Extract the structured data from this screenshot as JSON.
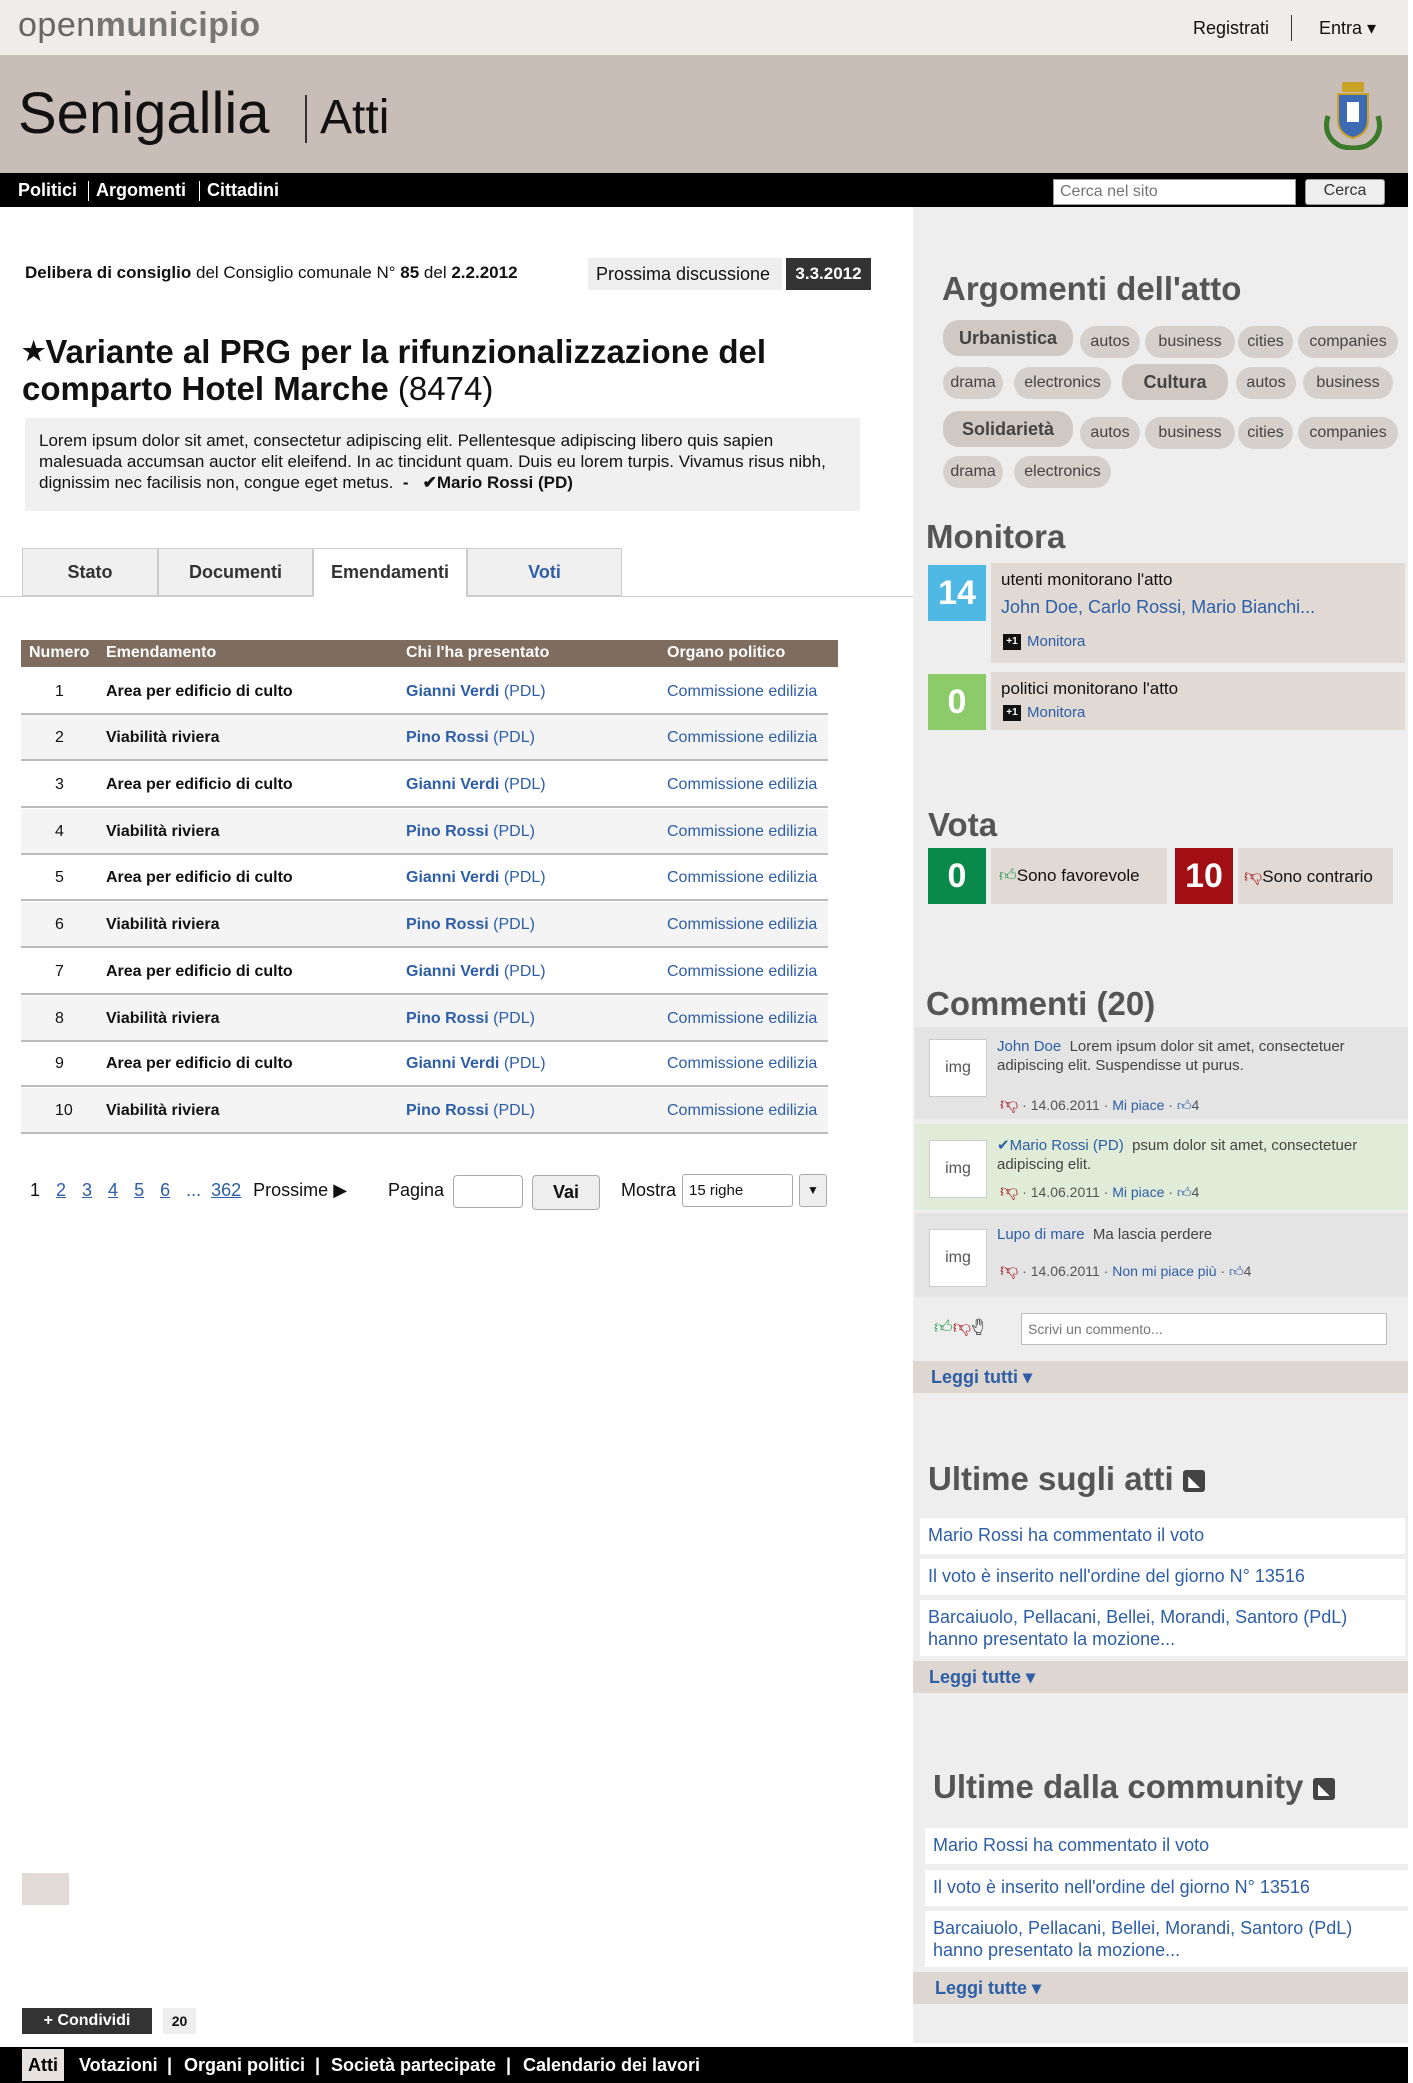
{
  "brand": {
    "open": "open",
    "municipio": "municipio"
  },
  "top": {
    "register": "Registrati",
    "login": "Entra ▾"
  },
  "header": {
    "city": "Senigallia",
    "section": "Atti"
  },
  "nav": {
    "items": [
      "Politici",
      "Argomenti",
      "Cittadini"
    ],
    "search_placeholder": "Cerca nel sito",
    "search_button": "Cerca"
  },
  "act": {
    "type": "Delibera di consiglio",
    "meta1": " del Consiglio comunale N° ",
    "number": "85",
    "meta2": " del ",
    "date": "2.2.2012",
    "next_label": "Prossima discussione",
    "next_date": "3.3.2012",
    "title": "Variante al PRG per la rifunzionalizzazione del comparto Hotel Marche",
    "id": "(8474)",
    "description": "Lorem ipsum dolor sit amet, consectetur adipiscing elit. Pellentesque adipiscing libero quis sapien malesuada accumsan auctor elit eleifend. In ac tincidunt quam. Duis eu lorem turpis. Vivamus risus nibh, dignissim nec facilisis non, congue eget metus.",
    "sep": "-",
    "author": "✔Mario Rossi (PD)"
  },
  "tabs": [
    "Stato",
    "Documenti",
    "Emendamenti",
    "Voti"
  ],
  "table": {
    "headers": [
      "Numero",
      "Emendamento",
      "Chi l'ha presentato",
      "Organo politico"
    ],
    "rows": [
      {
        "n": "1",
        "t": "Area per edificio di culto",
        "who": "Gianni Verdi",
        "party": "(PDL)",
        "org": "Commissione edilizia"
      },
      {
        "n": "2",
        "t": "Viabilità riviera",
        "who": "Pino Rossi",
        "party": "(PDL)",
        "org": "Commissione edilizia"
      },
      {
        "n": "3",
        "t": "Area per edificio di culto",
        "who": "Gianni Verdi",
        "party": "(PDL)",
        "org": "Commissione edilizia"
      },
      {
        "n": "4",
        "t": "Viabilità riviera",
        "who": "Pino Rossi",
        "party": "(PDL)",
        "org": "Commissione edilizia"
      },
      {
        "n": "5",
        "t": "Area per edificio di culto",
        "who": "Gianni Verdi",
        "party": "(PDL)",
        "org": "Commissione edilizia"
      },
      {
        "n": "6",
        "t": "Viabilità riviera",
        "who": "Pino Rossi",
        "party": "(PDL)",
        "org": "Commissione edilizia"
      },
      {
        "n": "7",
        "t": "Area per edificio di culto",
        "who": "Gianni Verdi",
        "party": "(PDL)",
        "org": "Commissione edilizia"
      },
      {
        "n": "8",
        "t": "Viabilità riviera",
        "who": "Pino Rossi",
        "party": "(PDL)",
        "org": "Commissione edilizia"
      },
      {
        "n": "9",
        "t": "Area per edificio di culto",
        "who": "Gianni Verdi",
        "party": "(PDL)",
        "org": "Commissione edilizia"
      },
      {
        "n": "10",
        "t": "Viabilità riviera",
        "who": "Pino Rossi",
        "party": "(PDL)",
        "org": "Commissione edilizia"
      }
    ]
  },
  "pager": {
    "current": "1",
    "pages": [
      "2",
      "3",
      "4",
      "5",
      "6"
    ],
    "ellipsis": "...",
    "last": "362",
    "next": "Prossime",
    "page_label": "Pagina",
    "go": "Vai",
    "show_label": "Mostra",
    "rows_value": "15 righe"
  },
  "share": {
    "label": "+ Condividi",
    "count": "20"
  },
  "footer": {
    "items": [
      "Atti",
      "Votazioni",
      "Organi politici",
      "Società partecipate",
      "Calendario dei lavori"
    ],
    "sep": "|"
  },
  "sidebar": {
    "topics_title": "Argomenti dell'atto",
    "topics": {
      "row1": [
        "Urbanistica",
        "autos",
        "business",
        "cities",
        "companies"
      ],
      "row2": [
        "drama",
        "electronics",
        "Cultura",
        "autos",
        "business"
      ],
      "row3": [
        "Solidarietà",
        "autos",
        "business",
        "cities",
        "companies"
      ],
      "row4": [
        "drama",
        "electronics"
      ]
    },
    "monitor_title": "Monitora",
    "monitor": {
      "users_count": "14",
      "users_label": "utenti monitorano l'atto",
      "users_names": "John Doe, Carlo Rossi, Mario Bianchi...",
      "pol_count": "0",
      "pol_label": "politici monitorano l'atto",
      "action": "Monitora",
      "plus": "+1"
    },
    "vote_title": "Vota",
    "vote": {
      "fav_count": "0",
      "fav_label": "Sono favorevole",
      "con_count": "10",
      "con_label": "Sono contrario",
      "fav_color": "#0a8a4a",
      "con_color": "#a10e13"
    },
    "comments_title": "Commenti (20)",
    "comments": [
      {
        "avatar": "img",
        "author": "John Doe",
        "text": "Lorem ipsum dolor sit amet, consectetuer adipiscing elit. Suspendisse ut purus.",
        "date": "14.06.2011",
        "action": "Mi piace",
        "likes": "4"
      },
      {
        "avatar": "img",
        "author": "✔Mario Rossi (PD)",
        "text": "psum dolor sit amet, consectetuer adipiscing elit.",
        "date": "14.06.2011",
        "action": "Mi piace",
        "likes": "4"
      },
      {
        "avatar": "img",
        "author": "Lupo di mare",
        "text": "Ma lascia perdere",
        "date": "14.06.2011",
        "action": "Non mi piace più",
        "likes": "4"
      }
    ],
    "comment_placeholder": "Scrivi un commento...",
    "read_all": "Leggi tutti ▾",
    "news_title": "Ultime sugli atti",
    "news": [
      "Mario Rossi ha commentato il voto",
      "Il voto è inserito nell'ordine del giorno N° 13516",
      "Barcaiuolo, Pellacani, Bellei, Morandi, Santoro (PdL) hanno presentato la mozione..."
    ],
    "read_all2": "Leggi tutte ▾",
    "community_title": "Ultime dalla community",
    "community": [
      "Mario Rossi ha commentato il voto",
      "Il voto è inserito nell'ordine del giorno N° 13516",
      "Barcaiuolo, Pellacani, Bellei, Morandi, Santoro (PdL) hanno presentato la mozione..."
    ],
    "read_all3": "Leggi tutte ▾"
  }
}
